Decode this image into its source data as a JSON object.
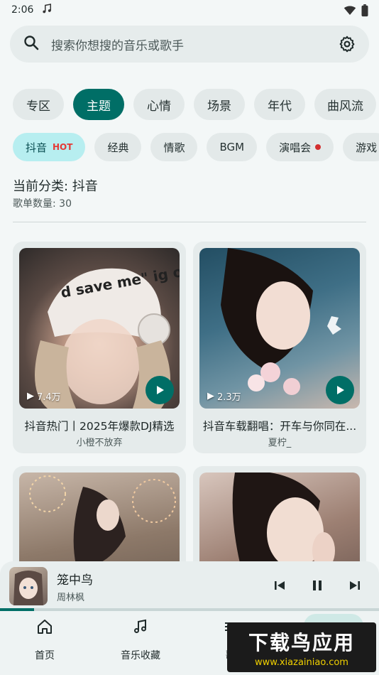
{
  "status": {
    "time": "2:06"
  },
  "search": {
    "placeholder": "搜索你想搜的音乐或歌手"
  },
  "tabs_primary": [
    "专区",
    "主题",
    "心情",
    "场景",
    "年代",
    "曲风流"
  ],
  "tabs_primary_active": "主题",
  "tabs_secondary": [
    {
      "label": "抖音",
      "badge": "HOT",
      "active": true
    },
    {
      "label": "经典"
    },
    {
      "label": "情歌"
    },
    {
      "label": "BGM"
    },
    {
      "label": "演唱会",
      "dot": true
    },
    {
      "label": "游戏"
    }
  ],
  "category": {
    "title": "当前分类: 抖音",
    "count": "歌单数量: 30"
  },
  "cards": [
    {
      "plays": "7.4万",
      "title": "抖音热门丨2025年爆款DJ精选",
      "author": "小橙不放弃",
      "image_overlay": "d save me\" ig or png?\""
    },
    {
      "plays": "2.3万",
      "title": "抖音车载翻唱：开车与你同在...",
      "author": "夏柠_"
    },
    {
      "plays": "",
      "title": "",
      "author": ""
    },
    {
      "plays": "",
      "title": "",
      "author": ""
    }
  ],
  "player": {
    "title": "笼中鸟",
    "artist": "周林枫",
    "progress": 0.09
  },
  "nav": [
    "首页",
    "音乐收藏",
    "歌"
  ],
  "watermark": {
    "main": "下载鸟应用",
    "url": "www.xiazainiao.com"
  },
  "colors": {
    "accent": "#006e66",
    "hot_chip": "#b7eef0",
    "hot_badge": "#e53935"
  }
}
